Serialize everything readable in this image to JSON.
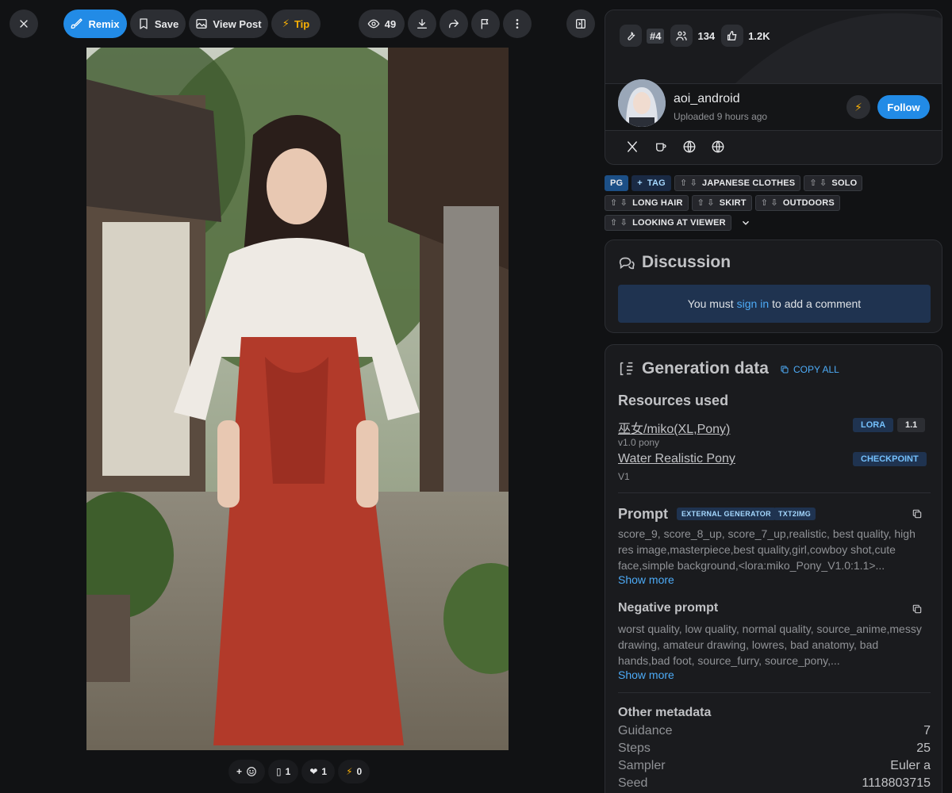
{
  "toolbar": {
    "remix_label": "Remix",
    "save_label": "Save",
    "view_post_label": "View Post",
    "tip_label": "Tip",
    "views_count": "49"
  },
  "reactions": {
    "emoji_count": "1",
    "heart_count": "1",
    "buzz_count": "0"
  },
  "stats": {
    "rank": "#4",
    "followers": "134",
    "likes": "1.2K"
  },
  "user": {
    "name": "aoi_android",
    "uploaded": "Uploaded 9 hours ago",
    "follow_label": "Follow"
  },
  "tags": {
    "rating": "PG",
    "add_tag": "TAG",
    "items": [
      "JAPANESE CLOTHES",
      "SOLO",
      "LONG HAIR",
      "SKIRT",
      "OUTDOORS",
      "LOOKING AT VIEWER"
    ]
  },
  "discussion": {
    "title": "Discussion",
    "prompt_before": "You must",
    "sign_in": "sign in",
    "prompt_after": "to add a comment"
  },
  "generation": {
    "title": "Generation data",
    "copy_all": "COPY ALL",
    "resources_heading": "Resources used",
    "resources": [
      {
        "name": "巫女/miko(XL,Pony)",
        "version": "v1.0 pony",
        "type": "LORA",
        "weight": "1.1"
      },
      {
        "name": "Water Realistic Pony",
        "version": "V1",
        "type": "CHECKPOINT"
      }
    ],
    "prompt_heading": "Prompt",
    "prompt_badges": [
      "EXTERNAL GENERATOR",
      "TXT2IMG"
    ],
    "prompt_text": "score_9, score_8_up, score_7_up,realistic, best quality, high res image,masterpiece,best quality,girl,cowboy shot,cute face,simple background,<lora:miko_Pony_V1.0:1.1>...",
    "show_more": "Show more",
    "negative_heading": "Negative prompt",
    "negative_text": "worst quality, low quality, normal quality, source_anime,messy drawing, amateur drawing, lowres, bad anatomy, bad hands,bad foot, source_furry, source_pony,...",
    "other_heading": "Other metadata",
    "meta": [
      {
        "label": "Guidance",
        "value": "7"
      },
      {
        "label": "Steps",
        "value": "25"
      },
      {
        "label": "Sampler",
        "value": "Euler a"
      },
      {
        "label": "Seed",
        "value": "1118803715"
      }
    ]
  }
}
